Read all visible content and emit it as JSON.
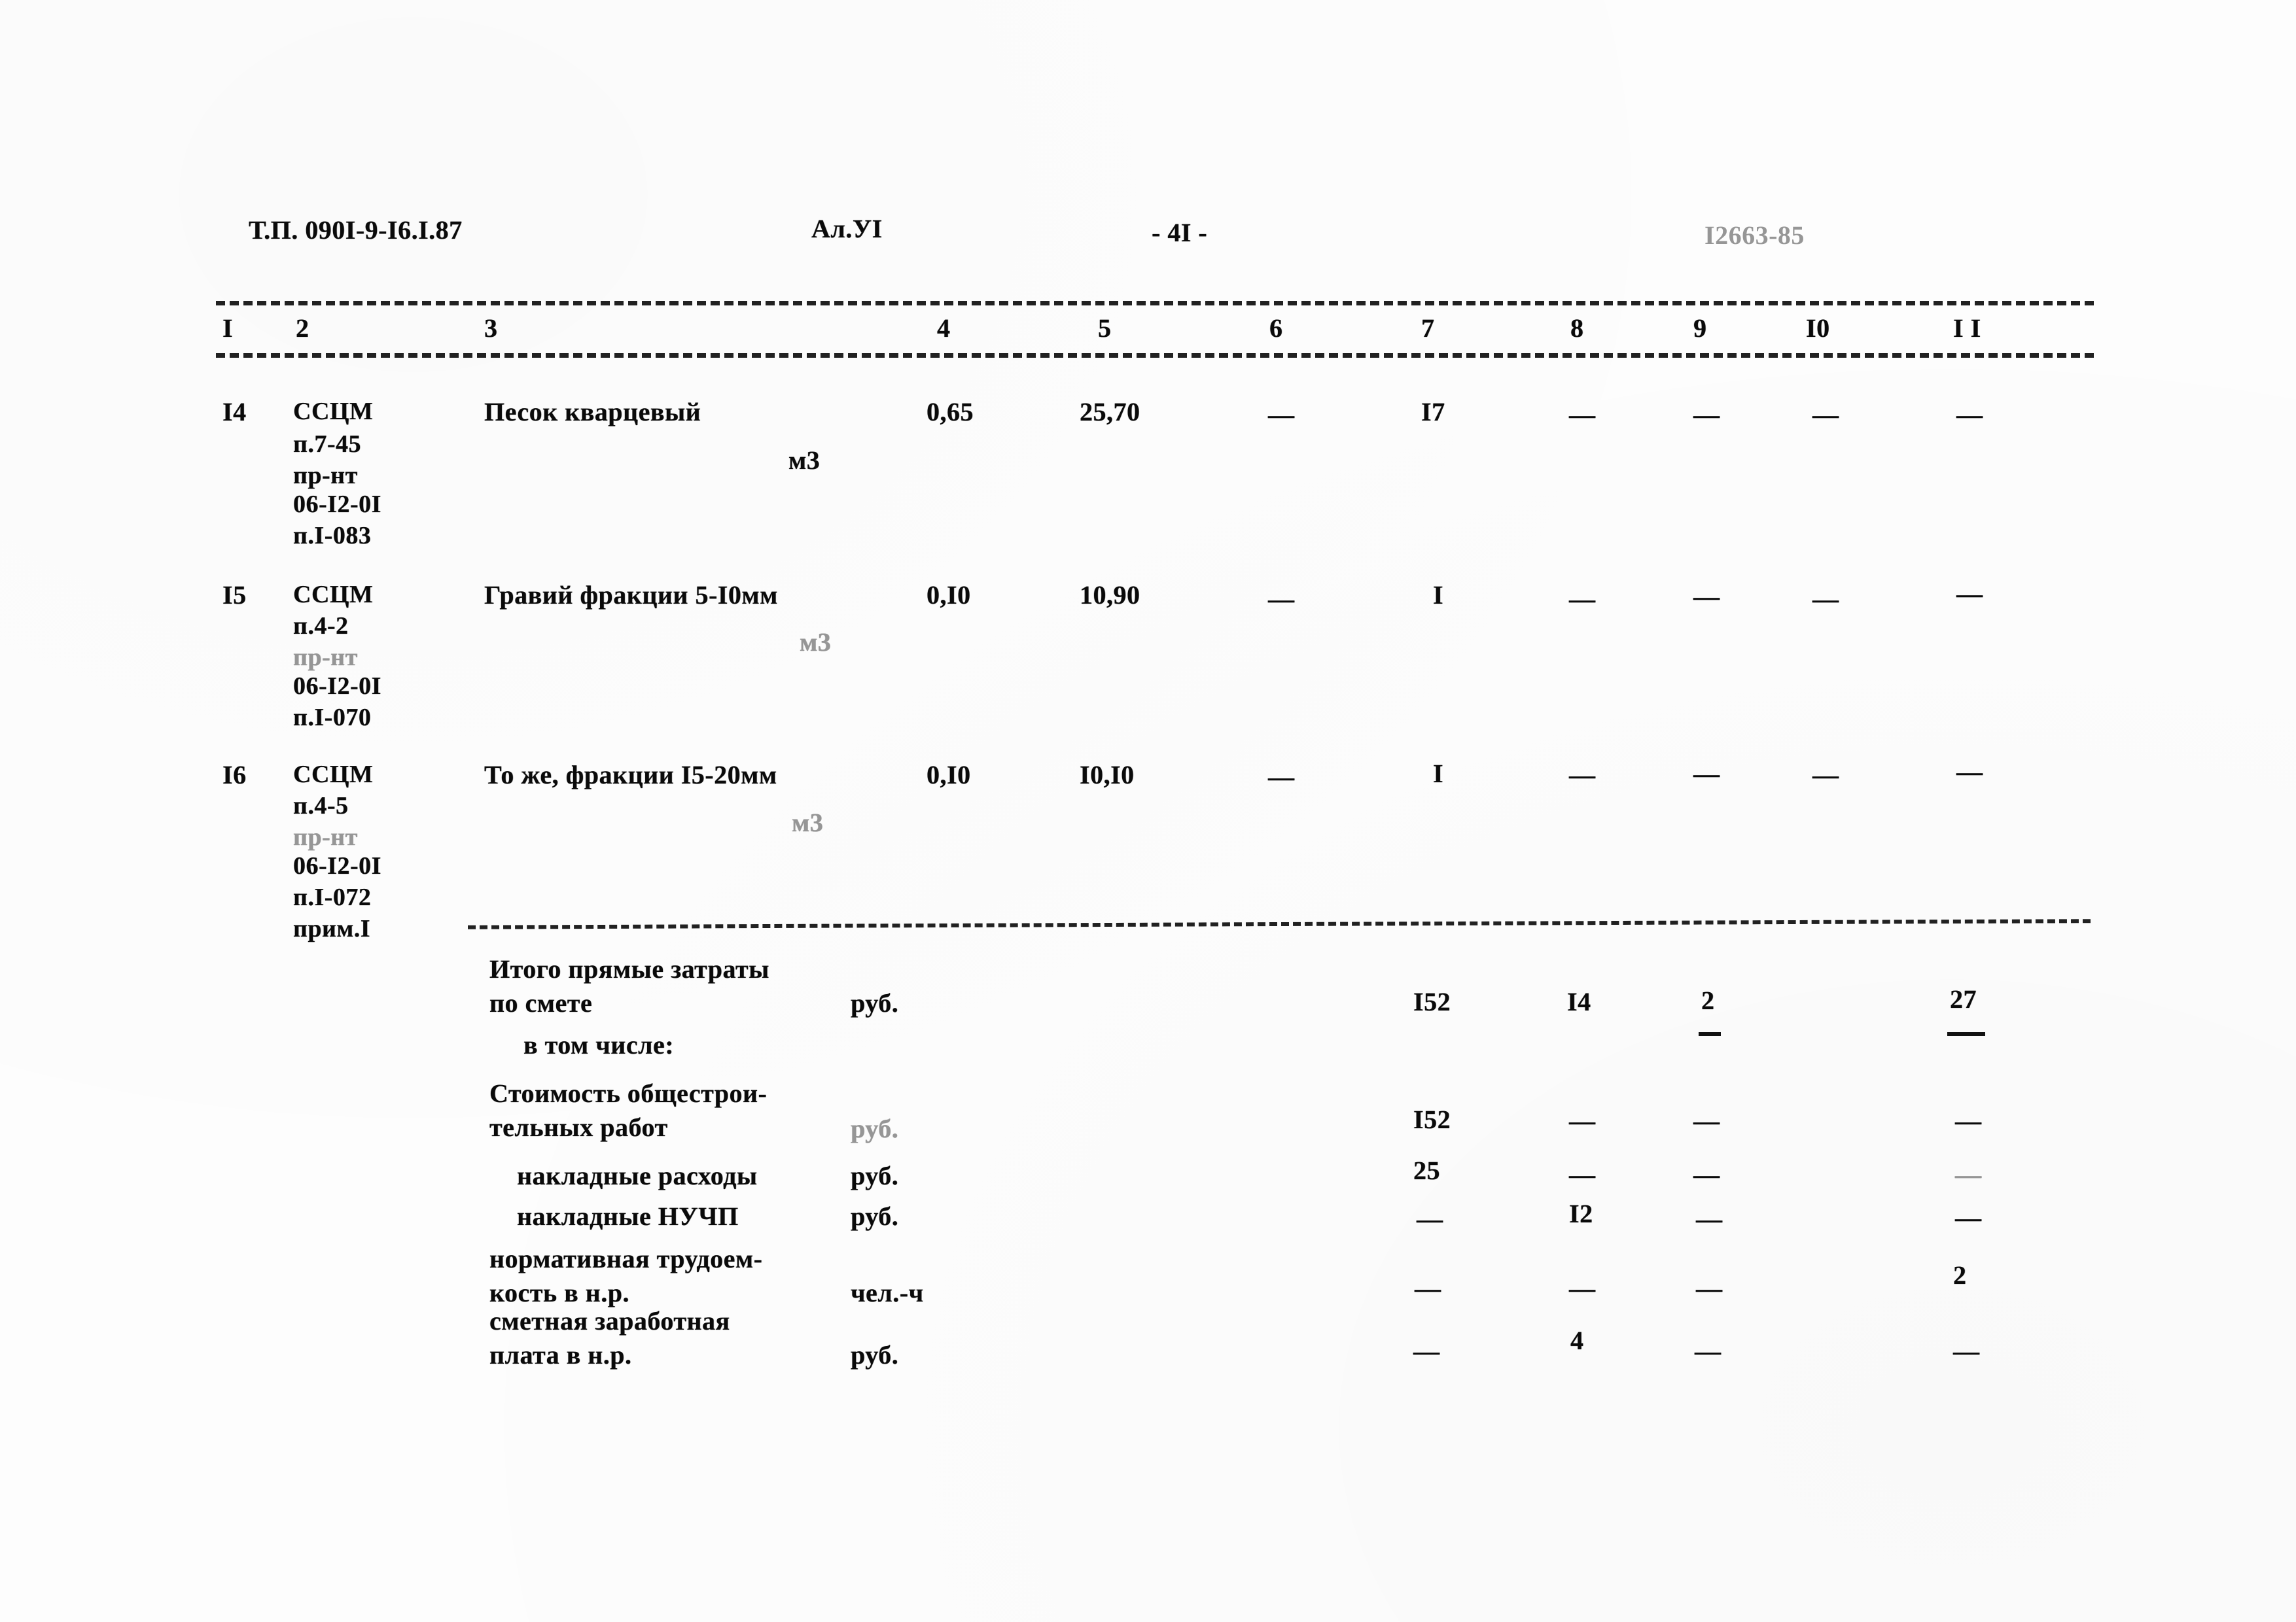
{
  "document": {
    "header": {
      "project_code": "Т.П. 090I-9-I6.I.87",
      "album": "Ал.УI",
      "page_marker": "- 4I -",
      "stamp": "I2663-85"
    },
    "column_numbers": [
      "I",
      "2",
      "3",
      "4",
      "5",
      "6",
      "7",
      "8",
      "9",
      "I0",
      "I I"
    ],
    "dash": "—",
    "rows": [
      {
        "num": "I4",
        "code_lines": [
          "ССЦМ",
          "п.7-45",
          "пр-нт",
          "06-I2-0I",
          "п.I-083"
        ],
        "description": "Песок кварцевый",
        "unit": "м3",
        "c4": "0,65",
        "c5": "25,70",
        "c6": "—",
        "c7": "I7",
        "c8": "—",
        "c9": "—",
        "c10": "—",
        "c11": "—"
      },
      {
        "num": "I5",
        "code_lines": [
          "ССЦМ",
          "п.4-2",
          "пр-нт",
          "06-I2-0I",
          "п.I-070"
        ],
        "description": "Гравий фракции 5-I0мм",
        "unit": "м3",
        "c4": "0,I0",
        "c5": "10,90",
        "c6": "—",
        "c7": "I",
        "c8": "—",
        "c9": "—",
        "c10": "—",
        "c11": "—"
      },
      {
        "num": "I6",
        "code_lines": [
          "ССЦМ",
          "п.4-5",
          "пр-нт",
          "06-I2-0I",
          "п.I-072",
          "прим.I"
        ],
        "description": "То же, фракции I5-20мм",
        "unit": "м3",
        "c4": "0,I0",
        "c5": "I0,I0",
        "c6": "—",
        "c7": "I",
        "c8": "—",
        "c9": "—",
        "c10": "—",
        "c11": "—"
      }
    ],
    "summary": {
      "total_label_line1": "Итого прямые затраты",
      "total_label_line2": "по смете",
      "total_unit": "руб.",
      "total_c7": "I52",
      "total_c8": "I4",
      "total_c9": "2",
      "total_c11": "27",
      "including_label": "в том числе:",
      "items": [
        {
          "label_line1": "Стоимость общестрои-",
          "label_line2": "тельных работ",
          "unit": "руб.",
          "c7": "I52",
          "c8": "—",
          "c9": "—",
          "c11": "—"
        },
        {
          "label_line1": "накладные расходы",
          "label_line2": "",
          "unit": "руб.",
          "c7": "25",
          "c8": "—",
          "c9": "—",
          "c11": "—"
        },
        {
          "label_line1": "накладные НУЧП",
          "label_line2": "",
          "unit": "руб.",
          "c7": "—",
          "c8": "I2",
          "c9": "—",
          "c11": "—"
        },
        {
          "label_line1": "нормативная трудоем-",
          "label_line2": "кость в н.р.",
          "unit": "чел.-ч",
          "c7": "—",
          "c8": "—",
          "c9": "—",
          "c11": "2"
        },
        {
          "label_line1": "сметная заработная",
          "label_line2": "плата в н.р.",
          "unit": "руб.",
          "c7": "—",
          "c8": "4",
          "c9": "—",
          "c11": "—"
        }
      ]
    }
  }
}
